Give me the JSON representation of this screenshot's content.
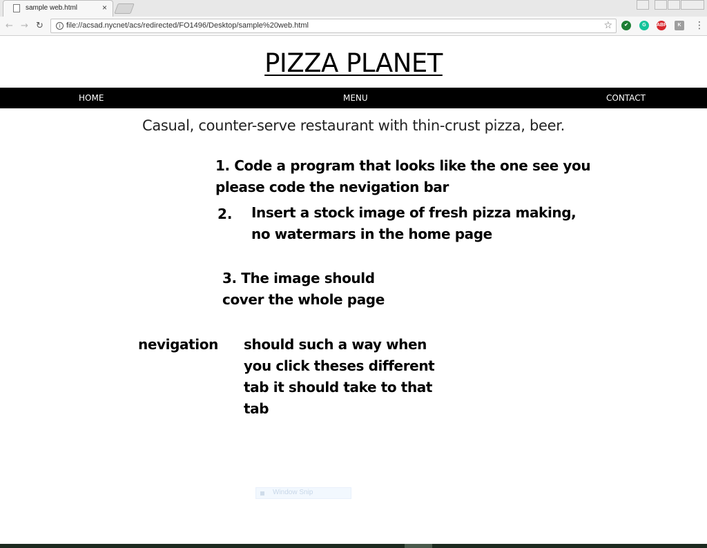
{
  "browser": {
    "tab_title": "sample web.html",
    "tab_close": "×",
    "url": "file://acsad.nycnet/acs/redirected/FO1496/Desktop/sample%20web.html",
    "back_icon": "←",
    "forward_icon": "→",
    "reload_icon": "↻",
    "info_icon": "i",
    "star_icon": "☆",
    "extensions": [
      {
        "name": "check-extension",
        "color": "#1e7e34",
        "glyph": "✔"
      },
      {
        "name": "grammarly-extension",
        "color": "#15c39a",
        "glyph": "G"
      },
      {
        "name": "adblock-extension",
        "color": "#d7262c",
        "glyph": "ABP"
      },
      {
        "name": "generic-extension",
        "color": "#9e9e9e",
        "glyph": "K"
      }
    ],
    "menu_icon": "⋮"
  },
  "site": {
    "title": "PIZZA PLANET",
    "nav": {
      "home": "HOME",
      "menu": "MENU",
      "contact": "CONTACT"
    },
    "tagline": "Casual, counter-serve restaurant with thin-crust pizza, beer."
  },
  "notes": {
    "item1_line1": "1. Code a program that looks like the one see you",
    "item1_line2": "please code the nevigation bar",
    "item2_num": "2.",
    "item2_line1": "Insert a stock image of fresh pizza making,",
    "item2_line2": "no watermars  in the home page",
    "item3_line1": "3.  The image should",
    "item3_line2": "cover the whole page",
    "nav_label": "nevigation",
    "nav_line1": "should such a way when",
    "nav_line2": "you click theses different",
    "nav_line3": "tab it should take to that",
    "nav_line4": "tab"
  },
  "overlay": {
    "window_snip": "Window Snip"
  }
}
